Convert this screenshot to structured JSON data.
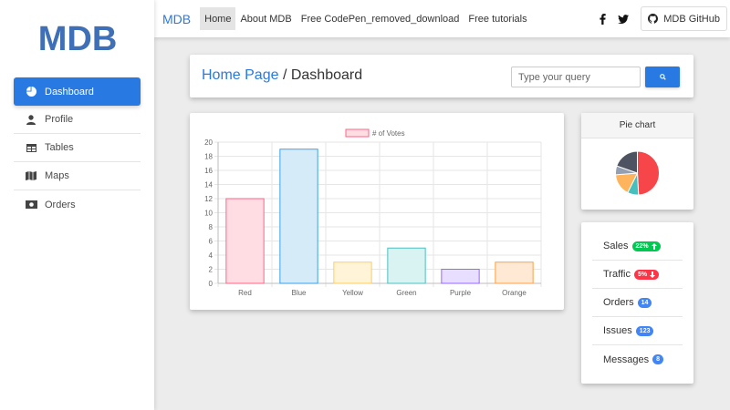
{
  "colors": {
    "accent": "#2979e3",
    "success": "#00c851",
    "danger": "#ff3547",
    "info": "#4285f4"
  },
  "sidebar": {
    "logo_text": "MDB",
    "items": [
      {
        "label": "Dashboard",
        "icon": "pie-chart-icon",
        "active": true
      },
      {
        "label": "Profile",
        "icon": "user-icon",
        "active": false
      },
      {
        "label": "Tables",
        "icon": "table-icon",
        "active": false
      },
      {
        "label": "Maps",
        "icon": "map-icon",
        "active": false
      },
      {
        "label": "Orders",
        "icon": "money-icon",
        "active": false
      }
    ]
  },
  "navbar": {
    "brand": "MDB",
    "links": [
      {
        "label": "Home",
        "active": true
      },
      {
        "label": "About MDB",
        "active": false
      },
      {
        "label": "Free CodePen_removed_download",
        "active": false
      },
      {
        "label": "Free tutorials",
        "active": false
      }
    ],
    "social_icons": [
      "facebook-icon",
      "twitter-icon"
    ],
    "github_label": "MDB GitHub"
  },
  "header": {
    "home_link": "Home Page",
    "separator": " / ",
    "current": "Dashboard",
    "search_placeholder": "Type your query"
  },
  "chart_data": {
    "type": "bar",
    "categories": [
      "Red",
      "Blue",
      "Yellow",
      "Green",
      "Purple",
      "Orange"
    ],
    "series": [
      {
        "name": "# of Votes",
        "values": [
          12,
          19,
          3,
          5,
          2,
          3
        ]
      }
    ],
    "ylim": [
      0,
      20
    ],
    "yticks": [
      0,
      2,
      4,
      6,
      8,
      10,
      12,
      14,
      16,
      18,
      20
    ],
    "grid": true,
    "legend": "top",
    "fills": [
      "#ffdde3",
      "#d6ebf8",
      "#fff3d8",
      "#d9f2f2",
      "#e8deff",
      "#ffe9d4"
    ],
    "strokes": [
      "#ff6384",
      "#36a2eb",
      "#ffce56",
      "#4bc0c0",
      "#9966ff",
      "#ff9f40"
    ]
  },
  "pie": {
    "title": "Pie chart",
    "chart_data": {
      "type": "pie",
      "values": [
        300,
        50,
        100,
        40,
        120
      ],
      "colors": [
        "#f7464a",
        "#46bfbd",
        "#fdb45c",
        "#949fb1",
        "#4d5360"
      ]
    }
  },
  "stats": [
    {
      "label": "Sales",
      "badge": "22%",
      "color": "green",
      "arrow": "up"
    },
    {
      "label": "Traffic",
      "badge": "5%",
      "color": "red",
      "arrow": "down"
    },
    {
      "label": "Orders",
      "badge": "14",
      "color": "blue",
      "arrow": ""
    },
    {
      "label": "Issues",
      "badge": "123",
      "color": "blue",
      "arrow": ""
    },
    {
      "label": "Messages",
      "badge": "8",
      "color": "blue",
      "arrow": ""
    }
  ]
}
